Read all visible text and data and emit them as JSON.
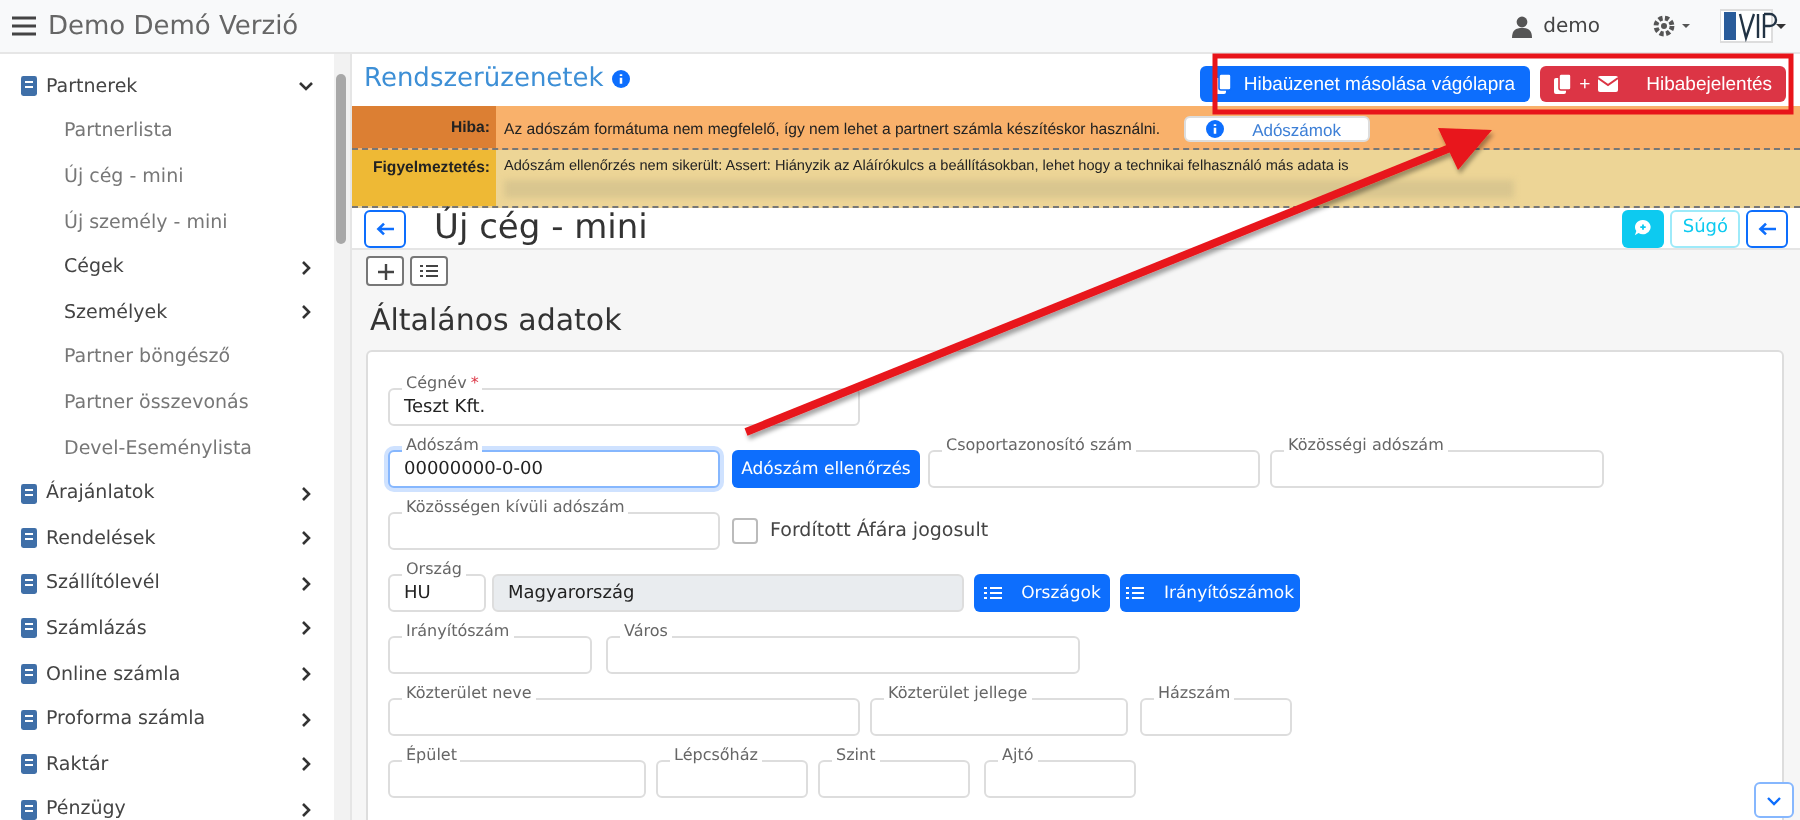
{
  "topbar": {
    "title": "Demo Demó Verzió",
    "user": "demo"
  },
  "sidebar": {
    "items": [
      {
        "label": "Partnerek",
        "expanded": true,
        "children": [
          {
            "label": "Partnerlista",
            "kind": "link"
          },
          {
            "label": "Új cég - mini",
            "kind": "link"
          },
          {
            "label": "Új személy - mini",
            "kind": "link"
          },
          {
            "label": "Cégek",
            "kind": "group",
            "expanded": false
          },
          {
            "label": "Személyek",
            "kind": "group",
            "expanded": false
          },
          {
            "label": "Partner böngésző",
            "kind": "link"
          },
          {
            "label": "Partner összevonás",
            "kind": "link"
          },
          {
            "label": "Devel-Eseménylista",
            "kind": "link"
          }
        ]
      },
      {
        "label": "Árajánlatok",
        "expanded": false
      },
      {
        "label": "Rendelések",
        "expanded": false
      },
      {
        "label": "Szállítólevél",
        "expanded": false
      },
      {
        "label": "Számlázás",
        "expanded": false
      },
      {
        "label": "Online számla",
        "expanded": false
      },
      {
        "label": "Proforma számla",
        "expanded": false
      },
      {
        "label": "Raktár",
        "expanded": false
      },
      {
        "label": "Pénzügy",
        "expanded": false
      }
    ]
  },
  "messages": {
    "title": "Rendszerüzenetek",
    "copy_button": "Hibaüzenet másolása vágólapra",
    "report_plus": "+",
    "report_button": "Hibabejelentés",
    "rows": [
      {
        "kind": "error",
        "label": "Hiba:",
        "text": "Az adószám formátuma nem megfelelő, így nem lehet a partnert számla készítéskor használni.",
        "button": "Adószámok"
      },
      {
        "kind": "warning",
        "label": "Figyelmeztetés:",
        "text": "Adószám ellenőrzés nem sikerült: Assert: Hiányzik az Aláírókulcs a beállításokban, lehet hogy a technikai felhasználó más adata is"
      }
    ]
  },
  "page": {
    "title": "Új cég - mini",
    "help_button": "Súgó"
  },
  "section": {
    "title": "Általános adatok",
    "required_mark": "*",
    "rows": [
      [
        {
          "kind": "field",
          "label": "Cégnév",
          "required": true,
          "value": "Teszt Kft.",
          "focused": false,
          "disabled": false
        }
      ],
      [
        {
          "kind": "field",
          "label": "Adószám",
          "required": false,
          "value": "00000000-0-00",
          "focused": true,
          "disabled": false
        },
        {
          "kind": "button",
          "label": "Adószám ellenőrzés"
        },
        {
          "kind": "field",
          "label": "Csoportazonosító szám",
          "required": false,
          "focused": false,
          "disabled": false
        },
        {
          "kind": "field",
          "label": "Közösségi adószám",
          "required": false,
          "focused": false,
          "disabled": false
        }
      ],
      [
        {
          "kind": "field",
          "label": "Közösségen kívüli adószám",
          "required": false,
          "focused": false,
          "disabled": false
        },
        {
          "kind": "checkbox",
          "label": "Fordított Áfára jogosult",
          "checked": false
        }
      ],
      [
        {
          "kind": "field",
          "label": "Ország",
          "required": false,
          "value": "HU",
          "focused": false,
          "disabled": false
        },
        {
          "kind": "field",
          "value": "Magyarország",
          "focused": false,
          "disabled": true
        },
        {
          "kind": "listbutton",
          "label": "Országok"
        },
        {
          "kind": "listbutton",
          "label": "Irányítószámok"
        }
      ],
      [
        {
          "kind": "field",
          "label": "Irányítószám",
          "required": false,
          "focused": false,
          "disabled": false
        },
        {
          "kind": "field",
          "label": "Város",
          "required": false,
          "focused": false,
          "disabled": false
        }
      ],
      [
        {
          "kind": "field",
          "label": "Közterület neve",
          "required": false,
          "focused": false,
          "disabled": false
        },
        {
          "kind": "field",
          "label": "Közterület jellege",
          "required": false,
          "focused": false,
          "disabled": false
        },
        {
          "kind": "field",
          "label": "Házszám",
          "required": false,
          "focused": false,
          "disabled": false
        }
      ],
      [
        {
          "kind": "field",
          "label": "Épület",
          "required": false,
          "focused": false,
          "disabled": false
        },
        {
          "kind": "field",
          "label": "Lépcsőház",
          "required": false,
          "focused": false,
          "disabled": false
        },
        {
          "kind": "field",
          "label": "Szint",
          "required": false,
          "focused": false,
          "disabled": false
        },
        {
          "kind": "field",
          "label": "Ajtó",
          "required": false,
          "focused": false,
          "disabled": false
        }
      ]
    ]
  }
}
